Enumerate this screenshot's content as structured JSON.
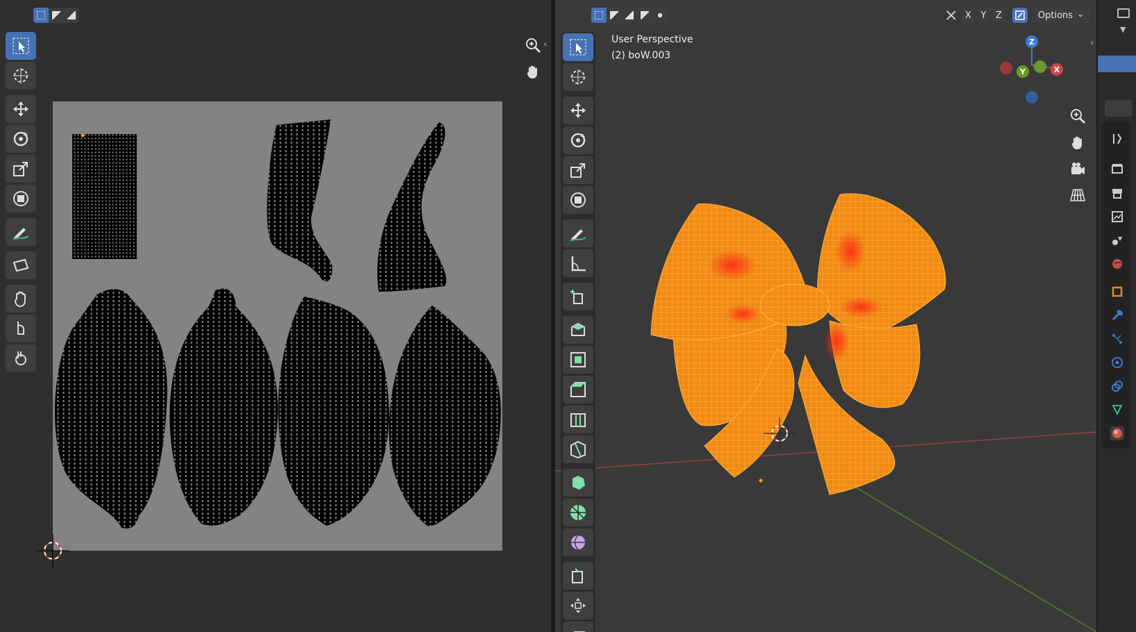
{
  "uv_editor": {
    "select_modes": [
      "select-new",
      "select-extend",
      "select-subtract"
    ],
    "tools": [
      "select-box",
      "cursor",
      "move",
      "rotate",
      "scale",
      "transform",
      "annotate",
      "rip-region",
      "grab",
      "relax",
      "pinch"
    ],
    "nav_buttons": [
      "zoom",
      "pan"
    ]
  },
  "viewport": {
    "perspective_label": "User Perspective",
    "object_label": "(2) boW.003",
    "axis_buttons": [
      "X",
      "Y",
      "Z"
    ],
    "options_label": "Options",
    "options_chevron": "⌄",
    "gizmo": {
      "z": "Z",
      "y": "Y",
      "x": "X"
    },
    "tools": [
      "select-box",
      "cursor",
      "move",
      "rotate",
      "scale",
      "transform",
      "annotate",
      "measure",
      "add-cube",
      "extrude",
      "inset",
      "bevel",
      "loop-cut",
      "knife",
      "poly-build",
      "spin",
      "smooth",
      "edge-slide",
      "shrink-fatten",
      "shear"
    ],
    "nav_buttons": [
      "zoom",
      "pan",
      "camera",
      "perspective-grid"
    ],
    "colors": {
      "wire": "#ff9a1a",
      "hot": "#ff3b1f",
      "x_axis": "#c84a4a",
      "y_axis": "#6a9a2a",
      "z_axis": "#3b7ad0"
    }
  },
  "properties": {
    "tabs": [
      "tool",
      "render",
      "output",
      "view-layer",
      "scene",
      "world",
      "object",
      "modifiers",
      "particles",
      "physics",
      "constraints",
      "data",
      "material"
    ]
  }
}
